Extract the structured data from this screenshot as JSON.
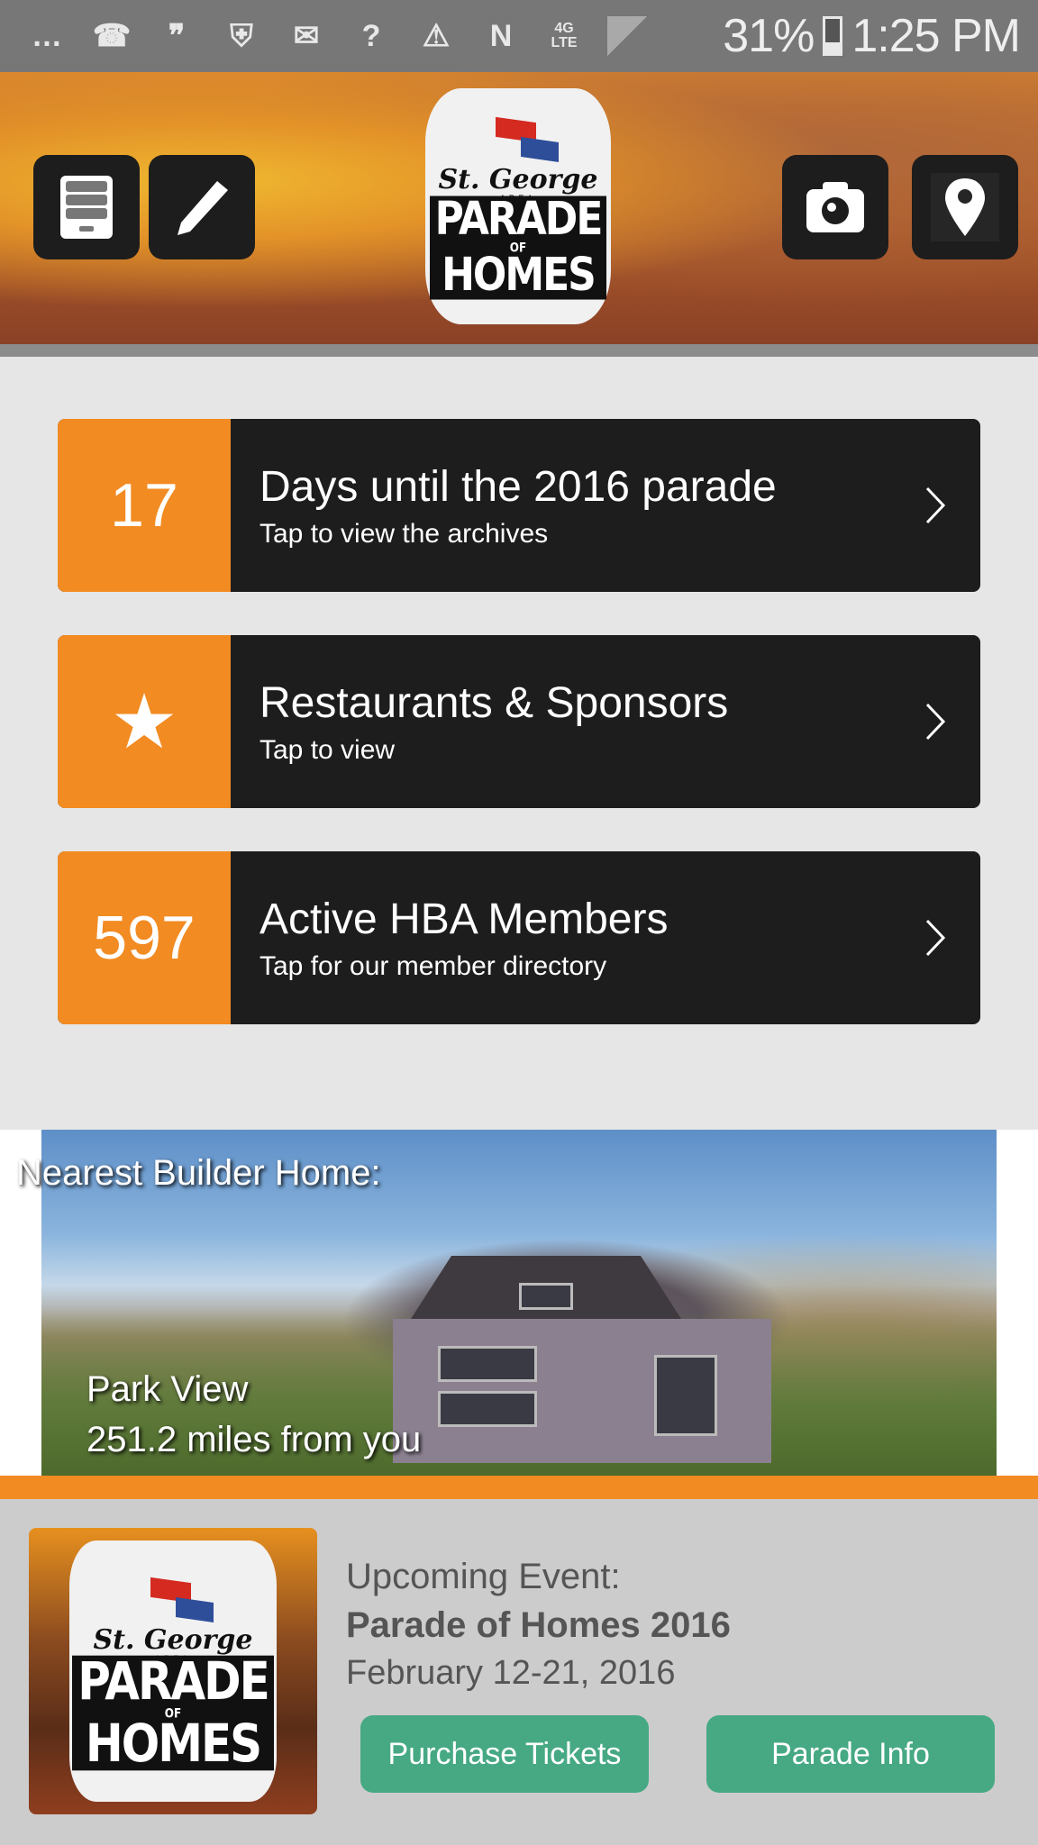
{
  "status_bar": {
    "icons": [
      "messages-icon",
      "missed-call-icon",
      "hangouts-icon",
      "shield-update-icon",
      "gmail-icon",
      "wifi-unknown-icon",
      "vpn-warning-icon",
      "nfc-icon",
      "4g-lte-icon",
      "signal-icon"
    ],
    "network": "4G LTE",
    "battery_percent": "31%",
    "time": "1:25 PM"
  },
  "header": {
    "logo": {
      "script": "St. George",
      "area": "AREA",
      "line1": "PARADE",
      "of": "OF",
      "line2": "HOMES"
    },
    "left_buttons": [
      "drawer-icon",
      "pencil-icon"
    ],
    "right_buttons": [
      "camera-icon",
      "map-pin-icon"
    ]
  },
  "cards": [
    {
      "badge": "17",
      "title": "Days until the 2016 parade",
      "subtitle": "Tap to view the archives"
    },
    {
      "badge": "★",
      "title": "Restaurants & Sponsors",
      "subtitle": "Tap to view"
    },
    {
      "badge": "597",
      "title": "Active HBA Members",
      "subtitle": "Tap for our member directory"
    }
  ],
  "nearest": {
    "label": "Nearest Builder Home:",
    "name": "Park View",
    "distance": "251.2 miles from you"
  },
  "event": {
    "label": "Upcoming Event:",
    "name": "Parade of Homes 2016",
    "date": "February 12-21, 2016",
    "buttons": {
      "purchase": "Purchase Tickets",
      "info": "Parade Info"
    }
  },
  "colors": {
    "accent_orange": "#f28b22",
    "card_dark": "#1d1d1d",
    "button_green": "#46a984",
    "status_bar": "#777777"
  }
}
